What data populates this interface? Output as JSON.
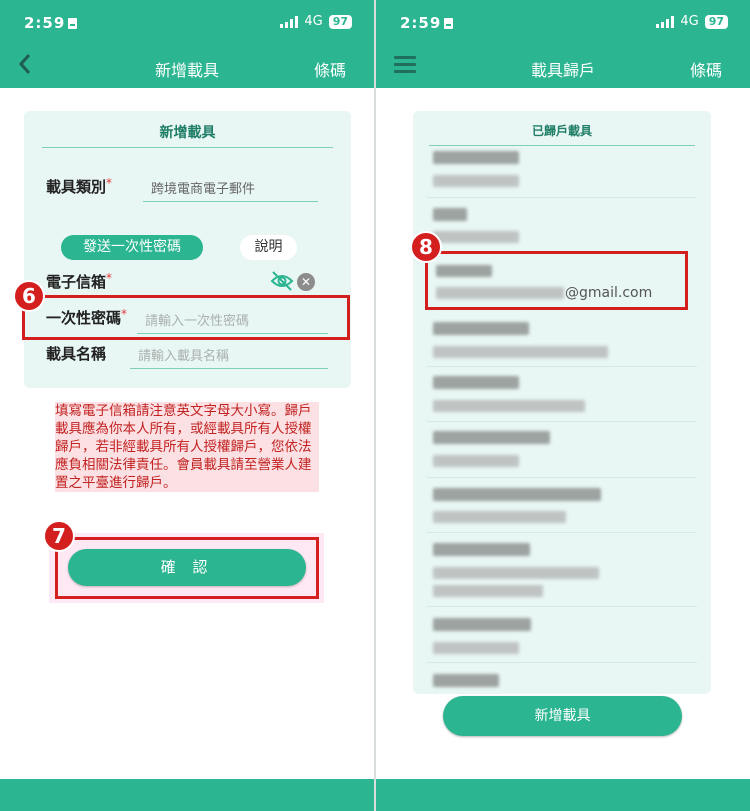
{
  "status": {
    "time": "2:59",
    "network": "4G",
    "battery": "97"
  },
  "left": {
    "header": {
      "back_icon": "chevron-left-icon",
      "title": "新增載具",
      "link": "條碼"
    },
    "card": {
      "title": "新增載具",
      "carrier_type": {
        "label": "載具類別",
        "required": "*",
        "value": "跨境電商電子郵件"
      },
      "send_otp_button": "發送一次性密碼",
      "explain_button": "說明",
      "email": {
        "label": "電子信箱",
        "required": "*",
        "eye_icon": "eye-off-icon",
        "clear_icon": "clear-icon"
      },
      "otp": {
        "label": "一次性密碼",
        "required": "*",
        "placeholder": "請輸入一次性密碼"
      },
      "carrier_name": {
        "label": "載具名稱",
        "placeholder": "請輸入載具名稱"
      }
    },
    "warning": "填寫電子信箱請注意英文字母大小寫。歸戶載具應為你本人所有，或經載具所有人授權歸戶，若非經載具所有人授權歸戶，您依法應負相關法律責任。會員載具請至營業人建置之平臺進行歸戶。",
    "confirm_button": "確 認",
    "step_badges": [
      "6",
      "7"
    ]
  },
  "right": {
    "header": {
      "menu_icon": "hamburger-menu-icon",
      "title": "載具歸戶",
      "link": "條碼"
    },
    "list_title": "已歸戶載具",
    "highlighted_email_suffix": "@gmail.com",
    "step_badge": "8",
    "add_button": "新增載具"
  },
  "colors": {
    "brand": "#2bb591",
    "highlight": "#d41f1f"
  }
}
